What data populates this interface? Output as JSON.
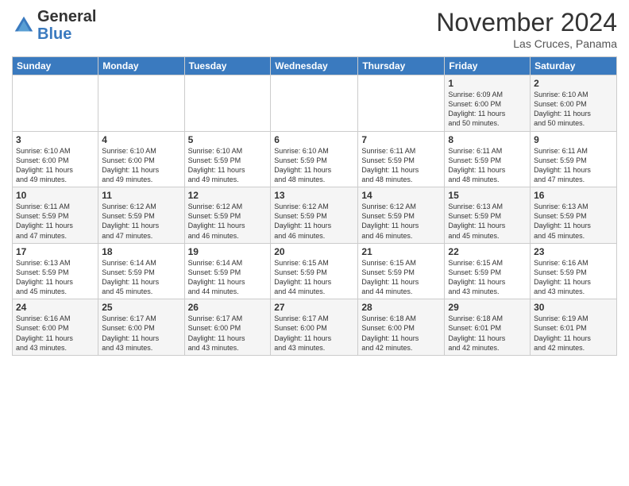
{
  "logo": {
    "general": "General",
    "blue": "Blue"
  },
  "header": {
    "title": "November 2024",
    "location": "Las Cruces, Panama"
  },
  "days_of_week": [
    "Sunday",
    "Monday",
    "Tuesday",
    "Wednesday",
    "Thursday",
    "Friday",
    "Saturday"
  ],
  "weeks": [
    [
      {
        "day": "",
        "info": ""
      },
      {
        "day": "",
        "info": ""
      },
      {
        "day": "",
        "info": ""
      },
      {
        "day": "",
        "info": ""
      },
      {
        "day": "",
        "info": ""
      },
      {
        "day": "1",
        "info": "Sunrise: 6:09 AM\nSunset: 6:00 PM\nDaylight: 11 hours\nand 50 minutes."
      },
      {
        "day": "2",
        "info": "Sunrise: 6:10 AM\nSunset: 6:00 PM\nDaylight: 11 hours\nand 50 minutes."
      }
    ],
    [
      {
        "day": "3",
        "info": "Sunrise: 6:10 AM\nSunset: 6:00 PM\nDaylight: 11 hours\nand 49 minutes."
      },
      {
        "day": "4",
        "info": "Sunrise: 6:10 AM\nSunset: 6:00 PM\nDaylight: 11 hours\nand 49 minutes."
      },
      {
        "day": "5",
        "info": "Sunrise: 6:10 AM\nSunset: 5:59 PM\nDaylight: 11 hours\nand 49 minutes."
      },
      {
        "day": "6",
        "info": "Sunrise: 6:10 AM\nSunset: 5:59 PM\nDaylight: 11 hours\nand 48 minutes."
      },
      {
        "day": "7",
        "info": "Sunrise: 6:11 AM\nSunset: 5:59 PM\nDaylight: 11 hours\nand 48 minutes."
      },
      {
        "day": "8",
        "info": "Sunrise: 6:11 AM\nSunset: 5:59 PM\nDaylight: 11 hours\nand 48 minutes."
      },
      {
        "day": "9",
        "info": "Sunrise: 6:11 AM\nSunset: 5:59 PM\nDaylight: 11 hours\nand 47 minutes."
      }
    ],
    [
      {
        "day": "10",
        "info": "Sunrise: 6:11 AM\nSunset: 5:59 PM\nDaylight: 11 hours\nand 47 minutes."
      },
      {
        "day": "11",
        "info": "Sunrise: 6:12 AM\nSunset: 5:59 PM\nDaylight: 11 hours\nand 47 minutes."
      },
      {
        "day": "12",
        "info": "Sunrise: 6:12 AM\nSunset: 5:59 PM\nDaylight: 11 hours\nand 46 minutes."
      },
      {
        "day": "13",
        "info": "Sunrise: 6:12 AM\nSunset: 5:59 PM\nDaylight: 11 hours\nand 46 minutes."
      },
      {
        "day": "14",
        "info": "Sunrise: 6:12 AM\nSunset: 5:59 PM\nDaylight: 11 hours\nand 46 minutes."
      },
      {
        "day": "15",
        "info": "Sunrise: 6:13 AM\nSunset: 5:59 PM\nDaylight: 11 hours\nand 45 minutes."
      },
      {
        "day": "16",
        "info": "Sunrise: 6:13 AM\nSunset: 5:59 PM\nDaylight: 11 hours\nand 45 minutes."
      }
    ],
    [
      {
        "day": "17",
        "info": "Sunrise: 6:13 AM\nSunset: 5:59 PM\nDaylight: 11 hours\nand 45 minutes."
      },
      {
        "day": "18",
        "info": "Sunrise: 6:14 AM\nSunset: 5:59 PM\nDaylight: 11 hours\nand 45 minutes."
      },
      {
        "day": "19",
        "info": "Sunrise: 6:14 AM\nSunset: 5:59 PM\nDaylight: 11 hours\nand 44 minutes."
      },
      {
        "day": "20",
        "info": "Sunrise: 6:15 AM\nSunset: 5:59 PM\nDaylight: 11 hours\nand 44 minutes."
      },
      {
        "day": "21",
        "info": "Sunrise: 6:15 AM\nSunset: 5:59 PM\nDaylight: 11 hours\nand 44 minutes."
      },
      {
        "day": "22",
        "info": "Sunrise: 6:15 AM\nSunset: 5:59 PM\nDaylight: 11 hours\nand 43 minutes."
      },
      {
        "day": "23",
        "info": "Sunrise: 6:16 AM\nSunset: 5:59 PM\nDaylight: 11 hours\nand 43 minutes."
      }
    ],
    [
      {
        "day": "24",
        "info": "Sunrise: 6:16 AM\nSunset: 6:00 PM\nDaylight: 11 hours\nand 43 minutes."
      },
      {
        "day": "25",
        "info": "Sunrise: 6:17 AM\nSunset: 6:00 PM\nDaylight: 11 hours\nand 43 minutes."
      },
      {
        "day": "26",
        "info": "Sunrise: 6:17 AM\nSunset: 6:00 PM\nDaylight: 11 hours\nand 43 minutes."
      },
      {
        "day": "27",
        "info": "Sunrise: 6:17 AM\nSunset: 6:00 PM\nDaylight: 11 hours\nand 43 minutes."
      },
      {
        "day": "28",
        "info": "Sunrise: 6:18 AM\nSunset: 6:00 PM\nDaylight: 11 hours\nand 42 minutes."
      },
      {
        "day": "29",
        "info": "Sunrise: 6:18 AM\nSunset: 6:01 PM\nDaylight: 11 hours\nand 42 minutes."
      },
      {
        "day": "30",
        "info": "Sunrise: 6:19 AM\nSunset: 6:01 PM\nDaylight: 11 hours\nand 42 minutes."
      }
    ]
  ]
}
